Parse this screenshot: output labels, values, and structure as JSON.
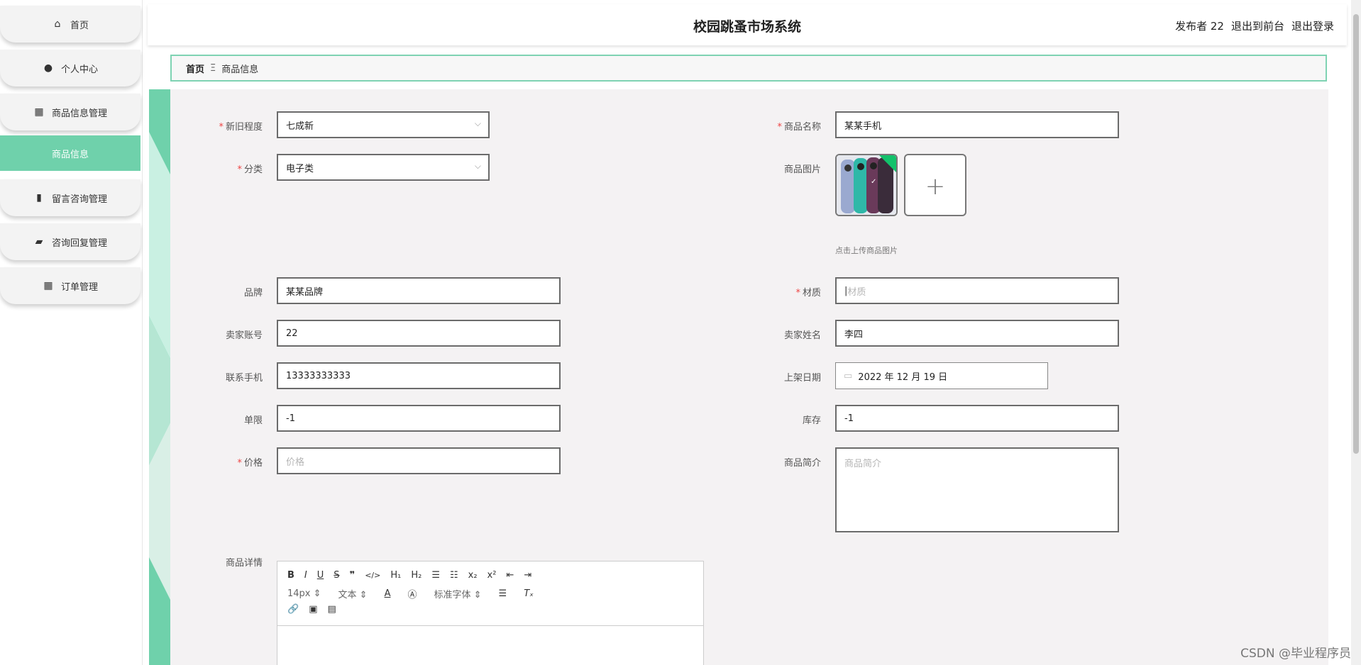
{
  "app": {
    "title": "校园跳蚤市场系统"
  },
  "header": {
    "user": "发布者 22",
    "front_label": "退出到前台",
    "logout_label": "退出登录"
  },
  "sidebar": {
    "items": [
      {
        "label": "首页",
        "icon": "home-icon"
      },
      {
        "label": "个人中心",
        "icon": "user-icon"
      },
      {
        "label": "商品信息管理",
        "icon": "grid-icon"
      },
      {
        "label": "商品信息",
        "icon": "none"
      },
      {
        "label": "留言咨询管理",
        "icon": "book-icon"
      },
      {
        "label": "咨询回复管理",
        "icon": "wallet-icon"
      },
      {
        "label": "订单管理",
        "icon": "grid-icon"
      }
    ]
  },
  "breadcrumb": {
    "home": "首页",
    "separator": "Ξ",
    "current": "商品信息"
  },
  "form": {
    "condition": {
      "label": "新旧程度",
      "value": "七成新"
    },
    "category": {
      "label": "分类",
      "value": "电子类"
    },
    "product_name": {
      "label": "商品名称",
      "value": "某某手机"
    },
    "product_image": {
      "label": "商品图片",
      "hint": "点击上传商品图片"
    },
    "brand": {
      "label": "品牌",
      "value": "某某品牌"
    },
    "material": {
      "label": "材质",
      "placeholder": "材质"
    },
    "seller_account": {
      "label": "卖家账号",
      "value": "22"
    },
    "seller_name": {
      "label": "卖家姓名",
      "value": "李四"
    },
    "phone": {
      "label": "联系手机",
      "value": "13333333333"
    },
    "listing_date": {
      "label": "上架日期",
      "value": "2022 年 12 月 19 日"
    },
    "limit": {
      "label": "单限",
      "value": "-1"
    },
    "stock": {
      "label": "库存",
      "value": "-1"
    },
    "price": {
      "label": "价格",
      "placeholder": "价格"
    },
    "intro": {
      "label": "商品简介",
      "placeholder": "商品简介"
    },
    "detail": {
      "label": "商品详情"
    }
  },
  "editor": {
    "font_size": "14px",
    "paragraph": "文本",
    "font_family": "标准字体"
  },
  "watermark": "CSDN @毕业程序员",
  "colors": {
    "accent": "#6fd1ab",
    "border": "#6b6b6b",
    "required": "#e44444"
  }
}
